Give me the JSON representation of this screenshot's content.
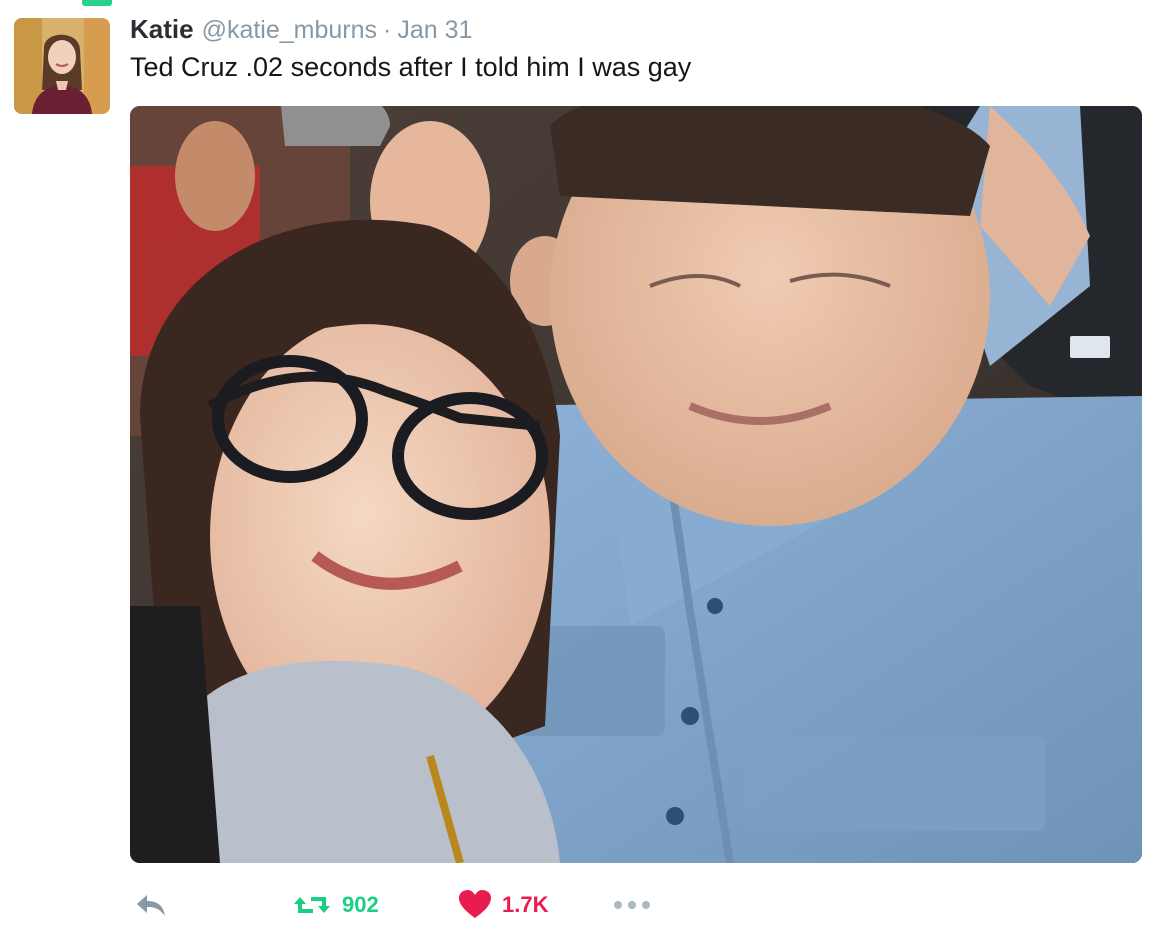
{
  "tweet": {
    "author": {
      "name": "Katie",
      "handle": "@katie_mburns"
    },
    "separator": "·",
    "date": "Jan 31",
    "text": "Ted Cruz .02 seconds after I told him I was gay",
    "actions": {
      "reply_icon": "reply-arrow-icon",
      "retweet_icon": "retweet-icon",
      "retweet_count": "902",
      "like_icon": "heart-icon",
      "like_count": "1.7K",
      "more_icon": "ellipsis-icon"
    },
    "colors": {
      "retweet": "#19cf86",
      "like": "#e81c4f",
      "muted": "#8899a6",
      "text": "#14171a"
    }
  }
}
